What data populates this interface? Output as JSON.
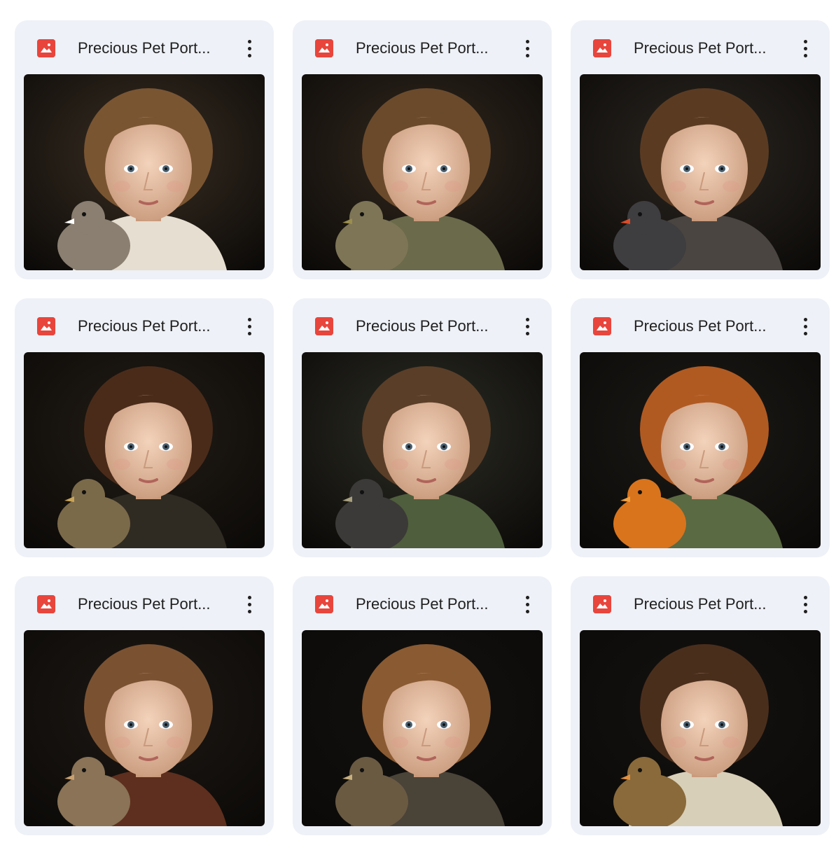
{
  "files": [
    {
      "title": "Precious Pet Port...",
      "icon": "image-icon",
      "subject": "boy with chick",
      "bg": "#3a2f23",
      "hair": "#7a5532",
      "clothes": "#e6ded0",
      "pet": "#8a7f70",
      "pet_accent": "#ffffff"
    },
    {
      "title": "Precious Pet Port...",
      "icon": "image-icon",
      "subject": "boy with chick",
      "bg": "#33291f",
      "hair": "#6b4a2c",
      "clothes": "#6b6a4a",
      "pet": "#7e7556",
      "pet_accent": "#9a8e4e"
    },
    {
      "title": "Precious Pet Port...",
      "icon": "image-icon",
      "subject": "boy with bird",
      "bg": "#2b2722",
      "hair": "#5a3b22",
      "clothes": "#4a4541",
      "pet": "#3e3d3f",
      "pet_accent": "#d94c2a"
    },
    {
      "title": "Precious Pet Port...",
      "icon": "image-icon",
      "subject": "girl with duckling",
      "bg": "#221c15",
      "hair": "#4a2b1a",
      "clothes": "#2f2b22",
      "pet": "#7b6a4a",
      "pet_accent": "#c9a55a"
    },
    {
      "title": "Precious Pet Port...",
      "icon": "image-icon",
      "subject": "child with duckling",
      "bg": "#2d2e26",
      "hair": "#5a3e28",
      "clothes": "#4f5e3c",
      "pet": "#3b3a38",
      "pet_accent": "#a8a080"
    },
    {
      "title": "Precious Pet Port...",
      "icon": "image-icon",
      "subject": "girl with chick",
      "bg": "#1c1a17",
      "hair": "#b05a22",
      "clothes": "#5a6a42",
      "pet": "#d9741c",
      "pet_accent": "#f0a040"
    },
    {
      "title": "Precious Pet Port...",
      "icon": "image-icon",
      "subject": "girl with duckling",
      "bg": "#1d1814",
      "hair": "#7a5232",
      "clothes": "#5e2f1e",
      "pet": "#8a7356",
      "pet_accent": "#c8a070"
    },
    {
      "title": "Precious Pet Port...",
      "icon": "image-icon",
      "subject": "child with duckling",
      "bg": "#121110",
      "hair": "#8a5a32",
      "clothes": "#4a4338",
      "pet": "#6a5a42",
      "pet_accent": "#c8b080"
    },
    {
      "title": "Precious Pet Port...",
      "icon": "image-icon",
      "subject": "girl with duckling",
      "bg": "#141210",
      "hair": "#4a2e1c",
      "clothes": "#d8cfb8",
      "pet": "#8a6a3a",
      "pet_accent": "#e09040"
    }
  ],
  "more_icon": "more-vert-icon",
  "accent": "#e8453c",
  "card_bg": "#eef1f7"
}
